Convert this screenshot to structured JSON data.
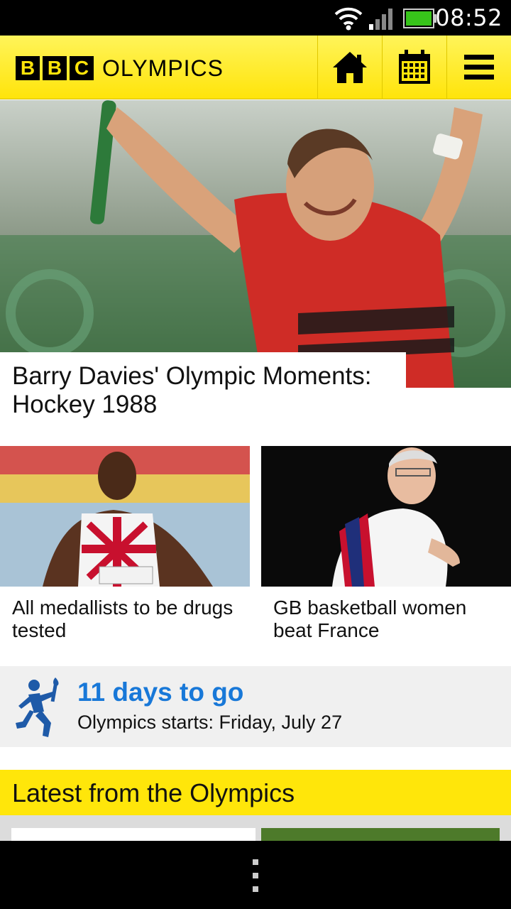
{
  "status_bar": {
    "time": "08:52"
  },
  "header": {
    "logo_letters": [
      "B",
      "B",
      "C"
    ],
    "logo_text": "OLYMPICS"
  },
  "hero": {
    "title": "Barry Davies' Olympic Moments: Hockey 1988"
  },
  "stories": [
    {
      "title": "All medallists to be drugs tested"
    },
    {
      "title": "GB basketball women beat France"
    }
  ],
  "countdown": {
    "days_label": "11 days to go",
    "subtitle": "Olympics starts: Friday, July 27"
  },
  "section": {
    "title": "Latest from the Olympics"
  },
  "colors": {
    "brand_yellow": "#ffe40a",
    "accent_blue": "#1878d8"
  }
}
